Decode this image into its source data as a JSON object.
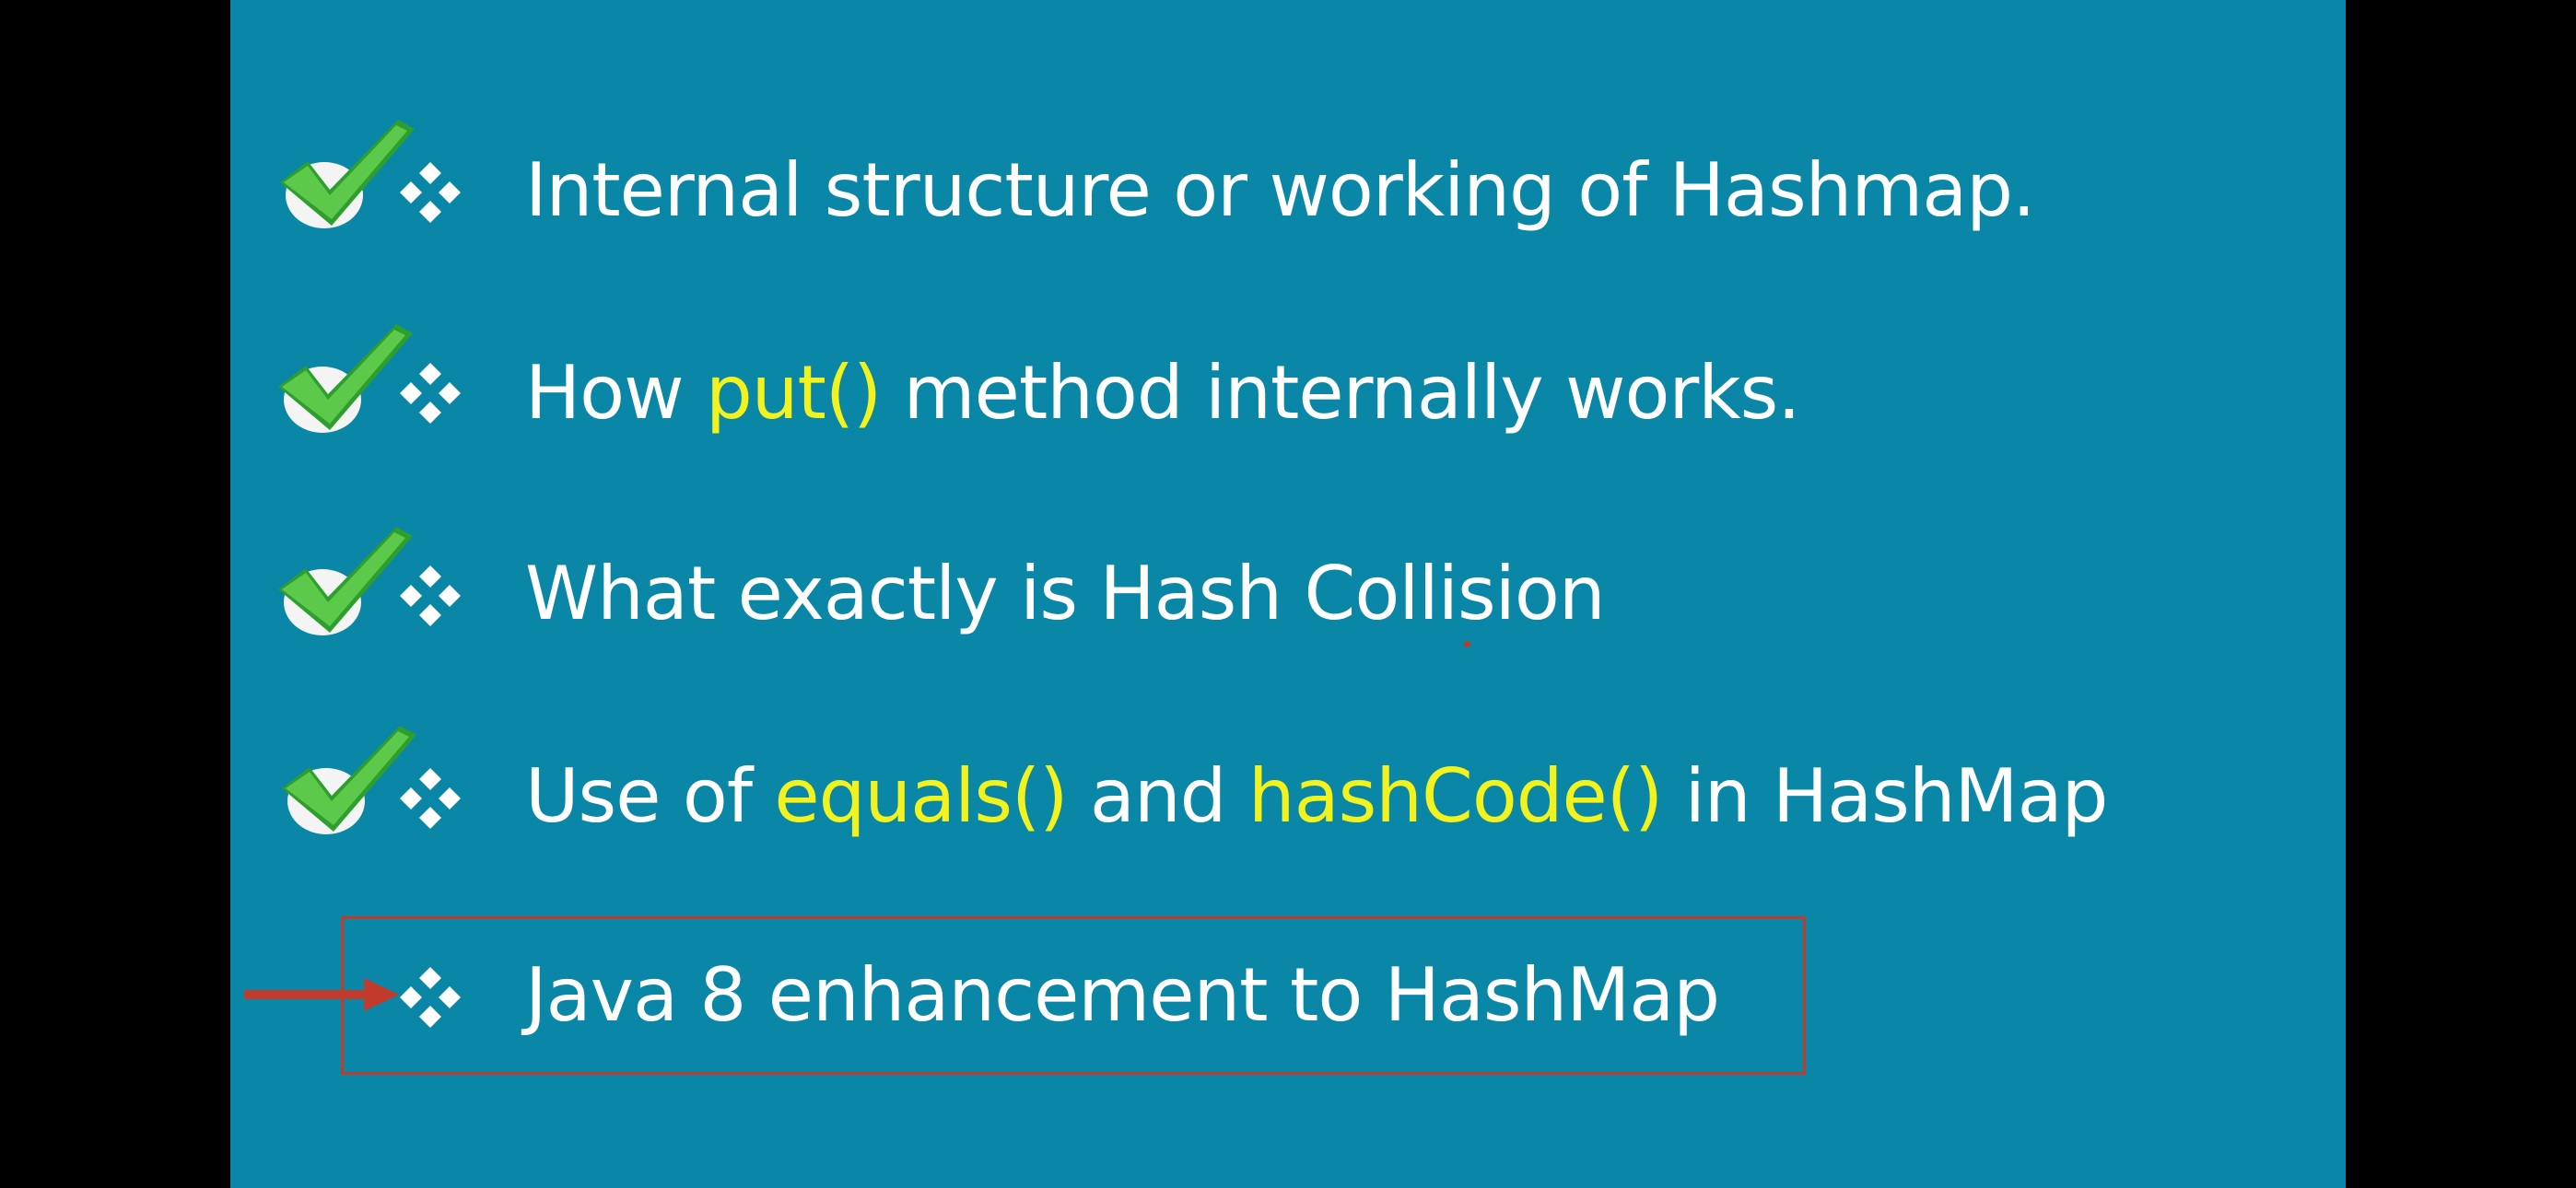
{
  "slide": {
    "items": [
      {
        "segments": [
          {
            "text": "Internal structure or working of Hashmap.",
            "highlight": false
          }
        ],
        "checked": true
      },
      {
        "segments": [
          {
            "text": "How ",
            "highlight": false
          },
          {
            "text": "put()",
            "highlight": true
          },
          {
            "text": " method internally works.",
            "highlight": false
          }
        ],
        "checked": true
      },
      {
        "segments": [
          {
            "text": "What exactly is Hash Collision",
            "highlight": false
          }
        ],
        "checked": true
      },
      {
        "segments": [
          {
            "text": "Use of ",
            "highlight": false
          },
          {
            "text": "equals()",
            "highlight": true
          },
          {
            "text": " and ",
            "highlight": false
          },
          {
            "text": "hashCode()",
            "highlight": true
          },
          {
            "text": " in HashMap",
            "highlight": false
          }
        ],
        "checked": true
      },
      {
        "segments": [
          {
            "text": "Java 8 enhancement to HashMap",
            "highlight": false
          }
        ],
        "checked": false,
        "current": true
      }
    ]
  },
  "colors": {
    "background": "#0a87a6",
    "highlight": "#f2f21f",
    "text": "#ffffff",
    "box_border": "#c23a2c",
    "check_green": "#3cb33c"
  },
  "icons": {
    "check": "check-mark-icon",
    "bullet": "diamond-bullet-icon",
    "arrow": "arrow-right-icon"
  }
}
